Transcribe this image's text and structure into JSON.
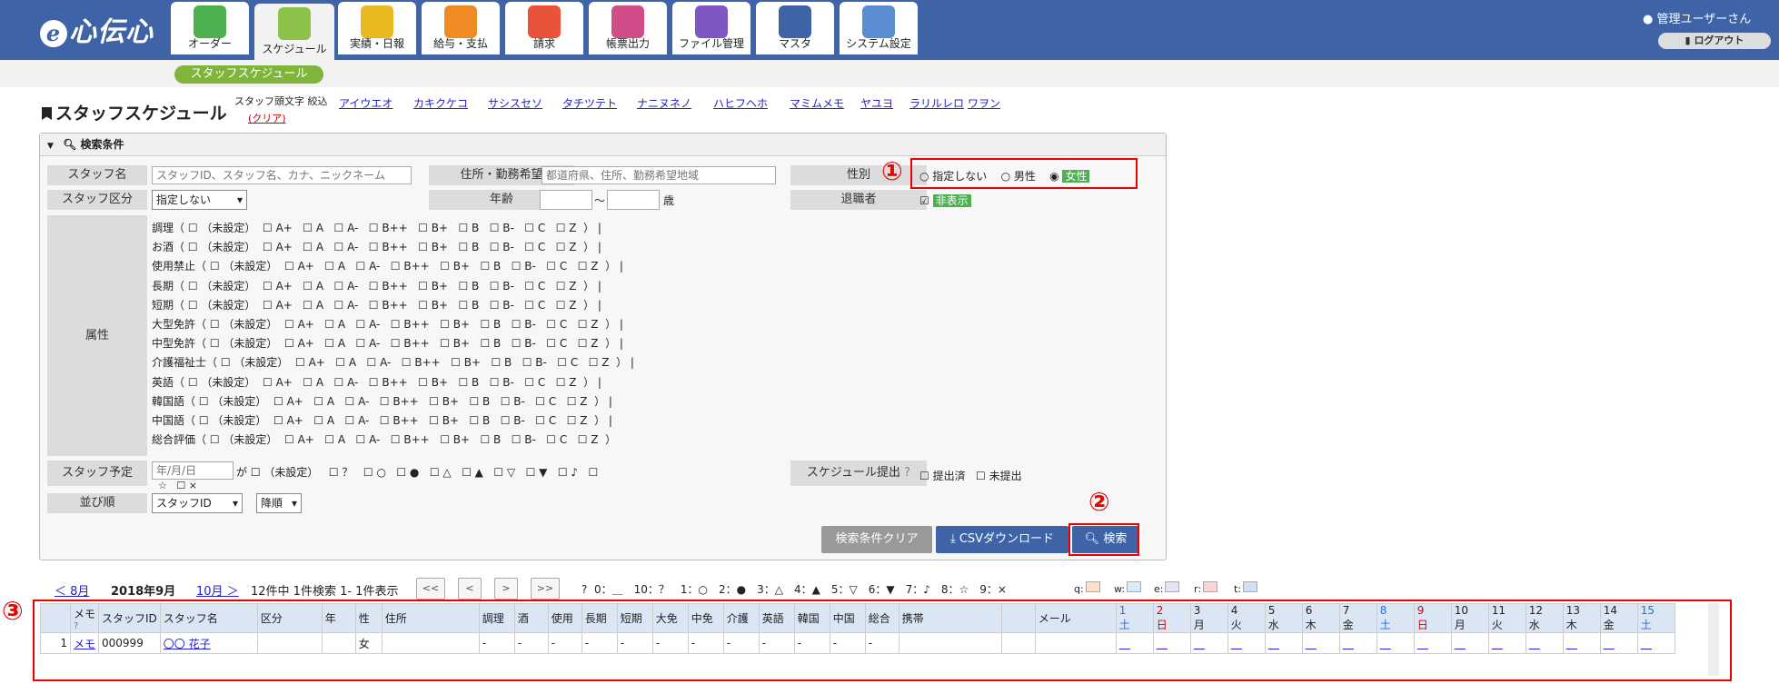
{
  "app": {
    "logo": "心伝心",
    "logo_prefix": "e"
  },
  "nav_tabs": [
    {
      "label": "オーダー",
      "icon": "handshake-icon"
    },
    {
      "label": "スケジュール",
      "icon": "calendar-icon",
      "active": true
    },
    {
      "label": "実績・日報",
      "icon": "book-icon"
    },
    {
      "label": "給与・支払",
      "icon": "person-money-icon"
    },
    {
      "label": "請求",
      "icon": "building-money-icon"
    },
    {
      "label": "帳票出力",
      "icon": "documents-icon"
    },
    {
      "label": "ファイル管理",
      "icon": "folder-icon"
    },
    {
      "label": "マスタ",
      "icon": "database-icon"
    },
    {
      "label": "システム設定",
      "icon": "monitor-settings-icon"
    }
  ],
  "user": {
    "name": "管理ユーザーさん",
    "logout": "ログアウト"
  },
  "sub_tab": "スタッフスケジュール",
  "page_title": "スタッフスケジュール",
  "kana_filter": {
    "label": "スタッフ頭文字 絞込",
    "clear": "(クリア)",
    "groups": [
      "アイウエオ",
      "カキクケコ",
      "サシスセソ",
      "タチツテト",
      "ナニヌネノ",
      "ハヒフヘホ",
      "マミムメモ",
      "ヤユヨ",
      "ラリルレロ",
      "ワヲン"
    ]
  },
  "search": {
    "header": "検索条件",
    "staff_name_label": "スタッフ名",
    "staff_name_placeholder": "スタッフID、スタッフ名、カナ、ニックネーム",
    "address_label": "住所・勤務希望",
    "address_placeholder": "都道府県、住所、勤務希望地域",
    "gender_label": "性別",
    "gender_options": [
      "指定しない",
      "男性",
      "女性"
    ],
    "gender_selected": "女性",
    "staff_type_label": "スタッフ区分",
    "staff_type_value": "指定しない",
    "age_label": "年齢",
    "age_tilde": "〜",
    "age_unit": "歳",
    "retired_label": "退職者",
    "retired_value": "非表示",
    "attr_label": "属性",
    "attributes": [
      "調理（ ☐ （未設定）  ☐ A+   ☐ A   ☐ A-   ☐ B++   ☐ B+   ☐ B   ☐ B-   ☐ C   ☐ Z  ） |",
      "お酒（ ☐ （未設定）  ☐ A+   ☐ A   ☐ A-   ☐ B++   ☐ B+   ☐ B   ☐ B-   ☐ C   ☐ Z  ） |",
      "使用禁止（ ☐ （未設定）  ☐ A+   ☐ A   ☐ A-   ☐ B++   ☐ B+   ☐ B   ☐ B-   ☐ C   ☐ Z  ） |",
      "長期（ ☐ （未設定）  ☐ A+   ☐ A   ☐ A-   ☐ B++   ☐ B+   ☐ B   ☐ B-   ☐ C   ☐ Z  ） |",
      "短期（ ☐ （未設定）  ☐ A+   ☐ A   ☐ A-   ☐ B++   ☐ B+   ☐ B   ☐ B-   ☐ C   ☐ Z  ） |",
      "大型免許（ ☐ （未設定）  ☐ A+   ☐ A   ☐ A-   ☐ B++   ☐ B+   ☐ B   ☐ B-   ☐ C   ☐ Z  ） |",
      "中型免許（ ☐ （未設定）  ☐ A+   ☐ A   ☐ A-   ☐ B++   ☐ B+   ☐ B   ☐ B-   ☐ C   ☐ Z  ） |",
      "介護福祉士（ ☐ （未設定）  ☐ A+   ☐ A   ☐ A-   ☐ B++   ☐ B+   ☐ B   ☐ B-   ☐ C   ☐ Z  ） |",
      "英語（ ☐ （未設定）  ☐ A+   ☐ A   ☐ A-   ☐ B++   ☐ B+   ☐ B   ☐ B-   ☐ C   ☐ Z  ） |",
      "韓国語（ ☐ （未設定）  ☐ A+   ☐ A   ☐ A-   ☐ B++   ☐ B+   ☐ B   ☐ B-   ☐ C   ☐ Z  ） |",
      "中国語（ ☐ （未設定）  ☐ A+   ☐ A   ☐ A-   ☐ B++   ☐ B+   ☐ B   ☐ B-   ☐ C   ☐ Z  ） |",
      "総合評価（ ☐ （未設定）  ☐ A+   ☐ A   ☐ A-   ☐ B++   ☐ B+   ☐ B   ☐ B-   ☐ C   ☐ Z  ）"
    ],
    "schedule_label": "スタッフ予定",
    "schedule_date_placeholder": "年/月/日",
    "schedule_ga": "が",
    "schedule_options": "☐ （未設定）   ☐ ？   ☐ ○   ☐ ●   ☐ △   ☐ ▲   ☐ ▽   ☐ ▼   ☐ ♪   ☐",
    "schedule_options_2": "☆   ☐ ×",
    "submit_label": "スケジュール提出",
    "submit_options": "☐ 提出済   ☐ 未提出",
    "order_label": "並び順",
    "order_value": "スタッフID",
    "order_dir": "降順",
    "clear_button": "検索条件クリア",
    "csv_button": "CSVダウンロード",
    "search_button": "検索"
  },
  "annotations": [
    "①",
    "②",
    "③"
  ],
  "pager": {
    "prev": "＜ 8月",
    "current": "2018年9月",
    "next": "10月 ＞",
    "count_text": "12件中 1件検索 1- 1件表示",
    "buttons": [
      "<<",
      "<",
      ">",
      ">>"
    ],
    "legend": "0：＿　10：？　1：○　2：●　3：△　4：▲　5：▽　6：▼　7：♪　8：☆　9：×",
    "color_legend": [
      "q:",
      "w:",
      "e:",
      "r:",
      "t:"
    ]
  },
  "table": {
    "headers": [
      "メモ",
      "スタッフID",
      "スタッフ名",
      "区分",
      "年",
      "性",
      "住所",
      "調理",
      "酒",
      "使用",
      "長期",
      "短期",
      "大免",
      "中免",
      "介護",
      "英語",
      "韓国",
      "中国",
      "総合",
      "携帯",
      "",
      "メール"
    ],
    "days": [
      {
        "d": "1",
        "w": "土"
      },
      {
        "d": "2",
        "w": "日"
      },
      {
        "d": "3",
        "w": "月"
      },
      {
        "d": "4",
        "w": "火"
      },
      {
        "d": "5",
        "w": "水"
      },
      {
        "d": "6",
        "w": "木"
      },
      {
        "d": "7",
        "w": "金"
      },
      {
        "d": "8",
        "w": "土"
      },
      {
        "d": "9",
        "w": "日"
      },
      {
        "d": "10",
        "w": "月"
      },
      {
        "d": "11",
        "w": "火"
      },
      {
        "d": "12",
        "w": "水"
      },
      {
        "d": "13",
        "w": "木"
      },
      {
        "d": "14",
        "w": "金"
      },
      {
        "d": "15",
        "w": "土"
      }
    ],
    "row": {
      "no": "1",
      "memo": "メモ",
      "id": "000999",
      "name": "〇〇 花子",
      "gender": "女",
      "dash": "-",
      "day_mark": "＿"
    }
  },
  "colors": {
    "header_bg": "#3e63a6",
    "accent_green": "#7fb53a",
    "annotation_red": "#e00000"
  }
}
